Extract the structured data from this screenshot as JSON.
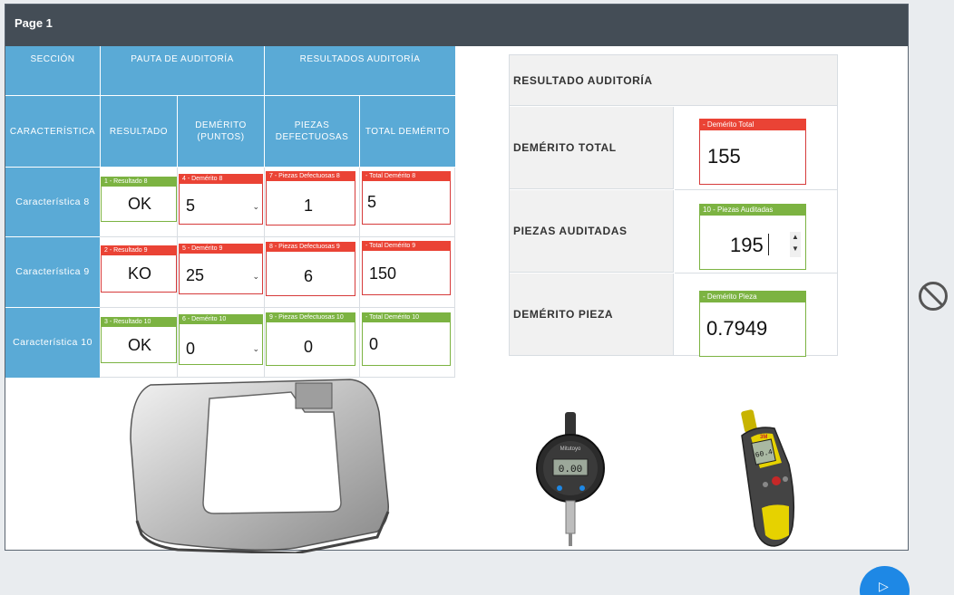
{
  "page": {
    "title": "Page 1"
  },
  "table": {
    "headers": {
      "seccion": "SECCIÓN",
      "pauta": "PAUTA DE AUDITORÍA",
      "resultados": "RESULTADOS AUDITORÍA",
      "caracteristica": "CARACTERÍSTICA",
      "resultado": "RESULTADO",
      "demerito": "DEMÉRITO\n(PUNTOS)",
      "piezas": "PIEZAS\nDEFECTUOSAS",
      "total": "TOTAL DEMÉRITO"
    },
    "rows": [
      {
        "name": "Característica 8",
        "resultado": {
          "tag": "1 - Resultado 8",
          "value": "OK"
        },
        "demerito": {
          "tag": "4 - Demérito 8",
          "value": "5"
        },
        "piezas": {
          "tag": "7 - Piezas Defectuosas 8",
          "value": "1"
        },
        "total": {
          "tag": "- Total Demérito 8",
          "value": "5"
        }
      },
      {
        "name": "Característica 9",
        "resultado": {
          "tag": "2 - Resultado 9",
          "value": "KO"
        },
        "demerito": {
          "tag": "5 - Demérito 9",
          "value": "25"
        },
        "piezas": {
          "tag": "8 - Piezas Defectuosas 9",
          "value": "6"
        },
        "total": {
          "tag": "- Total Demérito 9",
          "value": "150"
        }
      },
      {
        "name": "Característica 10",
        "resultado": {
          "tag": "3 - Resultado 10",
          "value": "OK"
        },
        "demerito": {
          "tag": "6 - Demérito 10",
          "value": "0"
        },
        "piezas": {
          "tag": "9 - Piezas Defectuosas 10",
          "value": "0"
        },
        "total": {
          "tag": "- Total Demérito 10",
          "value": "0"
        }
      }
    ]
  },
  "results": {
    "title": "RESULTADO AUDITORÍA",
    "demerito_total": {
      "label": "DEMÉRITO TOTAL",
      "tag": "- Demérito Total",
      "value": "155"
    },
    "piezas_auditadas": {
      "label": "PIEZAS AUDITADAS",
      "tag": "10 - Piezas Auditadas",
      "value": "195"
    },
    "demerito_pieza": {
      "label": "DEMÉRITO PIEZA",
      "tag": "- Demérito Pieza",
      "value": "0.7949"
    }
  },
  "gauge": {
    "display": "0.00",
    "brand": "Mitutoyo"
  },
  "meter": {
    "screen": "60.4",
    "brand": "3M"
  },
  "colors": {
    "header_blue": "#5aaad6",
    "error_red": "#ea4335",
    "ok_green": "#7cb342",
    "titlebar": "#444d56",
    "accent_blue": "#1e88e5"
  }
}
